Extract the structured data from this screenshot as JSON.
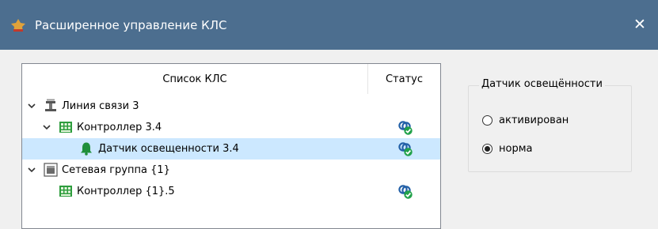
{
  "window": {
    "title": "Расширенное управление КЛС",
    "close_glyph": "✕"
  },
  "tree": {
    "columns": {
      "name": "Список КЛС",
      "status": "Статус"
    },
    "rows": [
      {
        "label": "Линия связи 3",
        "icon": "communication-line-icon",
        "expanded": true,
        "status": ""
      },
      {
        "label": "Контроллер 3.4",
        "icon": "controller-icon",
        "expanded": true,
        "status": "connected-ok-icon"
      },
      {
        "label": "Датчик освещенности 3.4",
        "icon": "bell-sensor-icon",
        "selected": true,
        "status": "connected-ok-icon"
      },
      {
        "label": "Сетевая группа {1}",
        "icon": "network-group-icon",
        "expanded": true,
        "status": ""
      },
      {
        "label": "Контроллер {1}.5",
        "icon": "controller-icon",
        "status": "connected-ok-icon"
      }
    ]
  },
  "sensor_group": {
    "legend": "Датчик освещённости",
    "options": [
      {
        "label": "активирован",
        "checked": false
      },
      {
        "label": "норма",
        "checked": true
      }
    ]
  },
  "colors": {
    "titlebar": "#4c6e8f",
    "selection": "#cce8ff",
    "controller_green": "#2e9d3e",
    "status_blue": "#2461a8",
    "status_green": "#22a24a"
  }
}
